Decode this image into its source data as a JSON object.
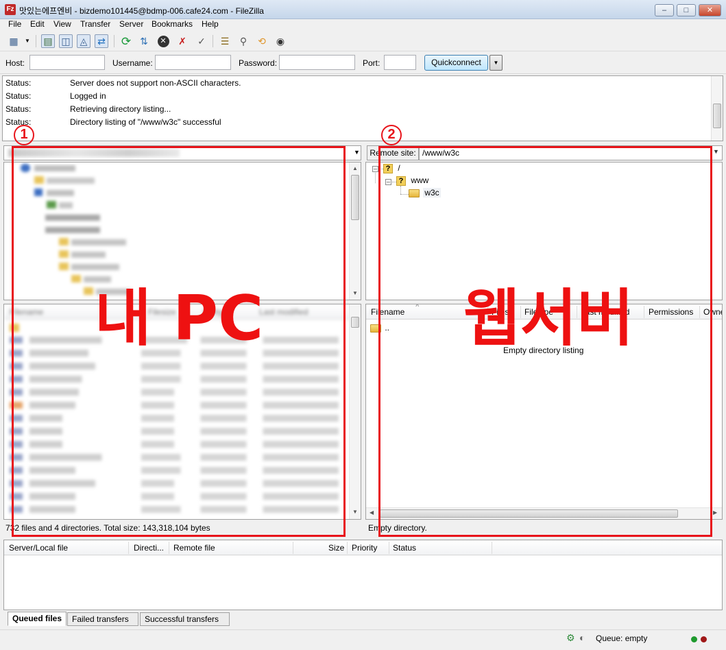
{
  "window": {
    "title": "맛있는에프엔비 - bizdemo101445@bdmp-006.cafe24.com - FileZilla",
    "app_icon_label": "Fz"
  },
  "menu": [
    "File",
    "Edit",
    "View",
    "Transfer",
    "Server",
    "Bookmarks",
    "Help"
  ],
  "toolbar_icons": [
    "site-manager-icon",
    "layout-log-icon",
    "layout-local-tree-icon",
    "layout-remote-tree-icon",
    "queue-toggle-icon",
    "refresh-icon",
    "process-queue-icon",
    "cancel-icon",
    "disconnect-icon",
    "reconnect-icon",
    "filter-icon",
    "compare-icon",
    "sync-browse-icon",
    "search-icon"
  ],
  "quickconnect": {
    "host_label": "Host:",
    "username_label": "Username:",
    "password_label": "Password:",
    "port_label": "Port:",
    "host_value": "",
    "username_value": "",
    "password_value": "",
    "port_value": "",
    "button_label": "Quickconnect"
  },
  "log": [
    {
      "type": "Status:",
      "message": "Server does not support non-ASCII characters."
    },
    {
      "type": "Status:",
      "message": "Logged in"
    },
    {
      "type": "Status:",
      "message": "Retrieving directory listing..."
    },
    {
      "type": "Status:",
      "message": "Directory listing of \"/www/w3c\" successful"
    }
  ],
  "local": {
    "status": "732 files and 4 directories. Total size: 143,318,104 bytes",
    "columns": [
      "Filename",
      "Filesize",
      "Filetype",
      "Last modified"
    ]
  },
  "remote": {
    "site_label": "Remote site:",
    "site_path": "/www/w3c",
    "tree": {
      "root": "/",
      "child": "www",
      "leaf": "w3c"
    },
    "columns": [
      "Filename",
      "Filesize",
      "Filetype",
      "Last modified",
      "Permissions",
      "Owner"
    ],
    "columns_visible": [
      "Filename",
      "Filesi",
      "Filetype",
      "Last modified",
      "Permissions",
      "Owne"
    ],
    "parent_dir": "..",
    "empty_message": "Empty directory listing",
    "status": "Empty directory."
  },
  "queue": {
    "columns": [
      "Server/Local file",
      "Directi...",
      "Remote file",
      "Size",
      "Priority",
      "Status"
    ],
    "tabs": [
      "Queued files",
      "Failed transfers",
      "Successful transfers"
    ],
    "status": "Queue: empty"
  },
  "annotations": {
    "marker_1": "1",
    "marker_2": "2",
    "local_label": "내 PC",
    "remote_label": "웹서버",
    "box_color": "#e8131a"
  }
}
